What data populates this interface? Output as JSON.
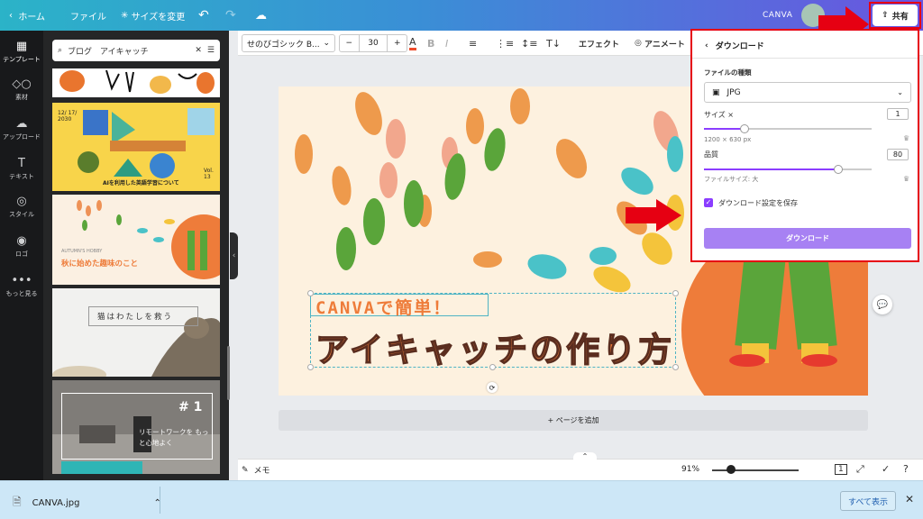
{
  "topbar": {
    "home": "ホーム",
    "file": "ファイル",
    "resize": "サイズを変更",
    "title": "CANVA",
    "share": "共有"
  },
  "rail": {
    "items": [
      {
        "label": "テンプレート",
        "icon": "template-icon"
      },
      {
        "label": "素材",
        "icon": "elements-icon"
      },
      {
        "label": "アップロード",
        "icon": "upload-icon"
      },
      {
        "label": "テキスト",
        "icon": "text-icon"
      },
      {
        "label": "スタイル",
        "icon": "style-icon"
      },
      {
        "label": "ロゴ",
        "icon": "logo-icon"
      },
      {
        "label": "もっと見る",
        "icon": "more-icon"
      }
    ]
  },
  "panel": {
    "search_value": "ブログ　アイキャッチ",
    "thumbs": {
      "t2_date": "12/ 17/ 2030",
      "t2_caption": "AIを利用した英語学習について",
      "t2_vol": "Vol. 13",
      "t3_small": "AUTUMN'S HOBBY",
      "t3_title": "秋に始めた趣味のこと",
      "t4_title": "猫はわたしを救う",
      "t5_num": "# 1",
      "t5_title": "リモートワークを もっと心地よく"
    }
  },
  "toolbar": {
    "font": "せのびゴシック B...",
    "font_size": "30",
    "effects": "エフェクト",
    "animate": "アニメート"
  },
  "canvas": {
    "subtitle": "CANVAで簡単！",
    "title": "アイキャッチの作り方",
    "add_page": "+ ページを追加"
  },
  "download_panel": {
    "header": "ダウンロード",
    "file_type_label": "ファイルの種類",
    "file_type_value": "JPG",
    "size_label": "サイズ ×",
    "size_value": "1",
    "size_slider": 0.24,
    "dimensions": "1200 × 630 px",
    "quality_label": "品質",
    "quality_value": "80",
    "quality_slider": 0.8,
    "filesize": "ファイルサイズ: 大",
    "save_settings": "ダウンロード設定を保存",
    "button": "ダウンロード"
  },
  "footer": {
    "memo": "メモ",
    "zoom": "91%",
    "page_count": "1"
  },
  "downloads_bar": {
    "file": "CANVA.jpg",
    "show_all": "すべて表示"
  },
  "colors": {
    "accent": "#8b3dff",
    "highlight": "#e60012",
    "title_orange": "#ee7c3a"
  }
}
